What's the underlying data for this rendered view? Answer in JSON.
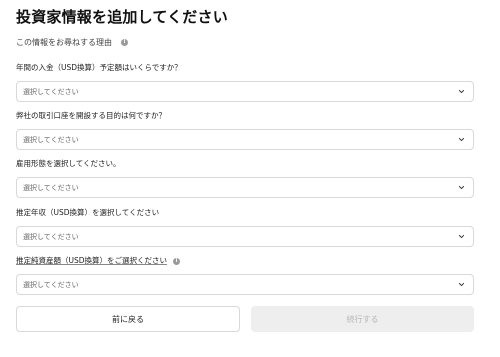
{
  "header": {
    "title": "投資家情報を追加してください",
    "reason_link": "この情報をお尋ねする理由",
    "reason_icon": "info-icon"
  },
  "fields": [
    {
      "label": "年間の入金（USD換算）予定額はいくらですか？",
      "placeholder": "選択してください",
      "icon": "chevron-down-icon"
    },
    {
      "label": "弊社の取引口座を開設する目的は何ですか？",
      "placeholder": "選択してください",
      "icon": "chevron-down-icon"
    },
    {
      "label": "雇用形態を選択してください。",
      "placeholder": "選択してください",
      "icon": "chevron-down-icon"
    },
    {
      "label": "推定年収（USD換算）を選択してください",
      "placeholder": "選択してください",
      "icon": "chevron-down-icon"
    },
    {
      "label": "推定純資産額（USD換算）をご選択ください",
      "placeholder": "選択してください",
      "icon": "chevron-down-icon",
      "info_icon": "info-icon"
    }
  ],
  "footer": {
    "back_label": "前に戻る",
    "continue_label": "続行する"
  },
  "colors": {
    "border": "#d9d9d9",
    "disabled_bg": "#eeeeee",
    "disabled_text": "#b7b7b7",
    "info_icon": "#9a9a9a"
  }
}
